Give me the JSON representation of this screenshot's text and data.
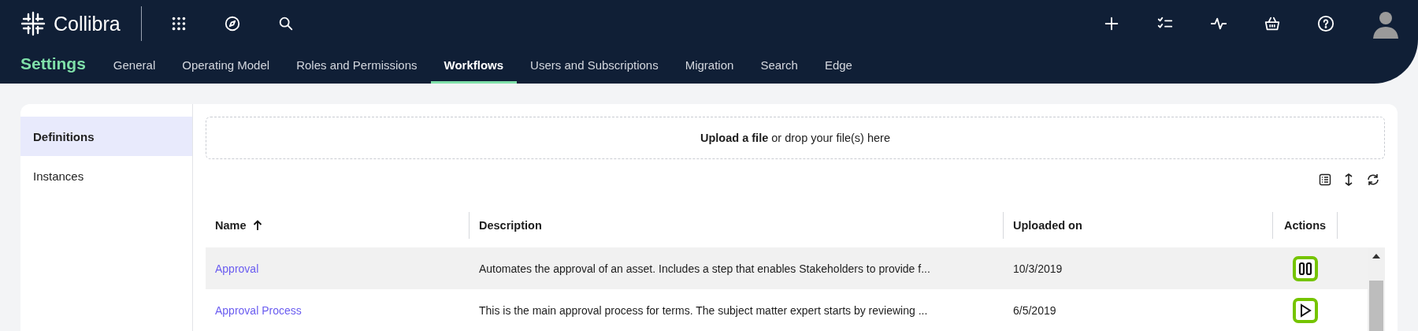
{
  "brand": {
    "name": "Collibra"
  },
  "section_title": "Settings",
  "tabs": [
    {
      "label": "General",
      "selected": false
    },
    {
      "label": "Operating Model",
      "selected": false
    },
    {
      "label": "Roles and Permissions",
      "selected": false
    },
    {
      "label": "Workflows",
      "selected": true
    },
    {
      "label": "Users and Subscriptions",
      "selected": false
    },
    {
      "label": "Migration",
      "selected": false
    },
    {
      "label": "Search",
      "selected": false
    },
    {
      "label": "Edge",
      "selected": false
    }
  ],
  "sidebar": {
    "items": [
      {
        "label": "Definitions",
        "selected": true
      },
      {
        "label": "Instances",
        "selected": false
      }
    ]
  },
  "upload": {
    "text": "**Upload a file** or drop your file(s) here"
  },
  "table": {
    "columns": [
      {
        "label": "Name",
        "sorted": true
      },
      {
        "label": "Description",
        "sorted": false
      },
      {
        "label": "Uploaded on",
        "sorted": false
      },
      {
        "label": "Actions",
        "sorted": false
      }
    ],
    "rows": [
      {
        "name": "Approval",
        "description": "Automates the approval of an asset. Includes a step that enables Stakeholders to provide f...",
        "uploaded_on": "10/3/2019",
        "kind": "pause",
        "selected": true
      },
      {
        "name": "Approval Process",
        "description": "This is the main approval process for terms. The subject matter expert starts by reviewing ...",
        "uploaded_on": "6/5/2019",
        "kind": "play",
        "selected": false
      }
    ]
  }
}
